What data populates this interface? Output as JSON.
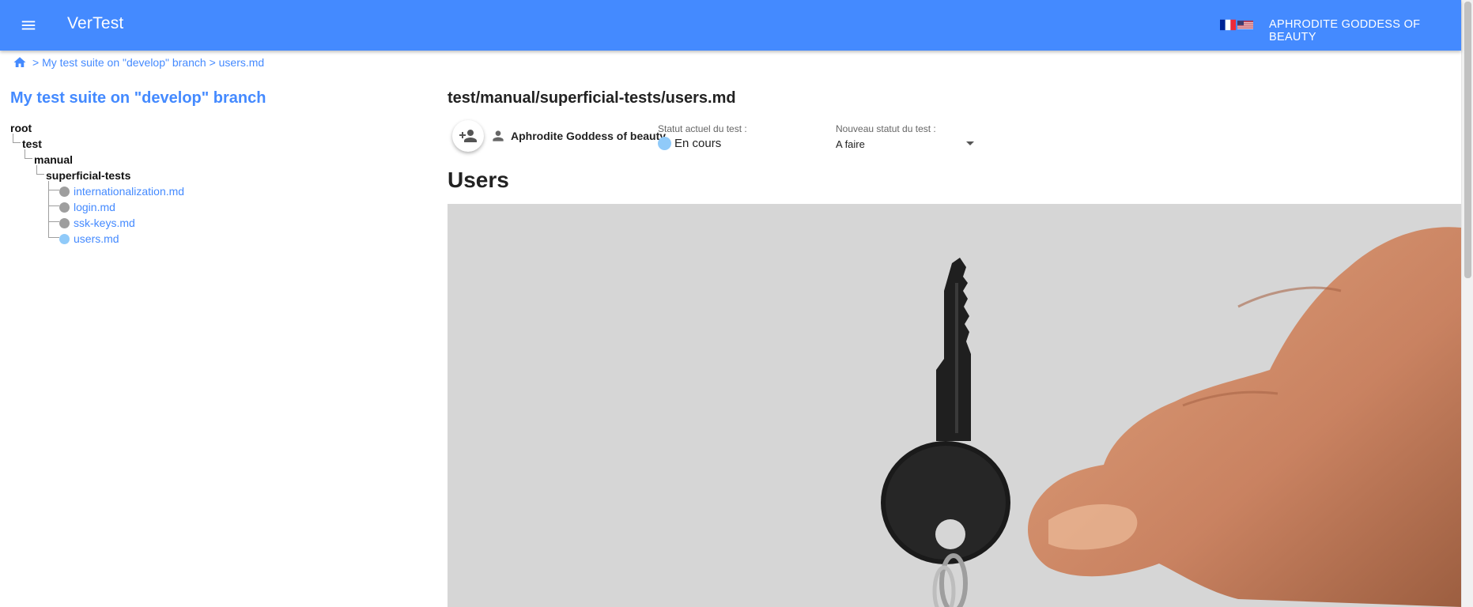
{
  "app": {
    "title": "VerTest",
    "user_label": "APHRODITE GODDESS OF BEAUTY",
    "accent_color": "#448aff"
  },
  "flags": [
    "flag-fr-icon",
    "flag-us-icon"
  ],
  "breadcrumb": {
    "home_icon": "home-icon",
    "path": "> My test suite on \"develop\" branch > users.md"
  },
  "sidebar": {
    "suite_title": "My test suite on \"develop\" branch",
    "tree": {
      "root": "root",
      "test": "test",
      "manual": "manual",
      "superficial": "superficial-tests",
      "files": [
        {
          "label": "internationalization.md",
          "status_color": "#9e9e9e"
        },
        {
          "label": "login.md",
          "status_color": "#9e9e9e"
        },
        {
          "label": "ssk-keys.md",
          "status_color": "#9e9e9e"
        },
        {
          "label": "users.md",
          "status_color": "#90caf9"
        }
      ]
    }
  },
  "main": {
    "file_path": "test/manual/superficial-tests/users.md",
    "assignee": "Aphrodite Goddess of beauty",
    "current_status_caption": "Statut actuel du test :",
    "current_status": "En cours",
    "current_status_color": "#90caf9",
    "new_status_caption": "Nouveau statut du test :",
    "new_status_value": "A faire",
    "doc_title": "Users",
    "image_alt": "hand-holding-key-image"
  }
}
